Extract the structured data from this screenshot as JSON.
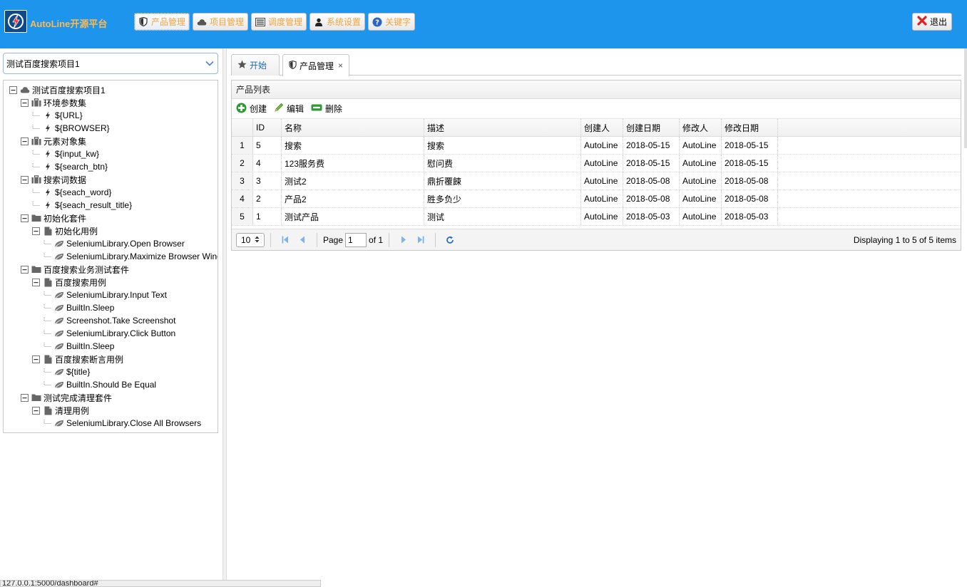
{
  "header": {
    "app_title": "AutoLine开源平台",
    "nav": [
      {
        "label": "产品管理",
        "icon": "shield-icon"
      },
      {
        "label": "项目管理",
        "icon": "cloud-icon"
      },
      {
        "label": "调度管理",
        "icon": "list-icon"
      },
      {
        "label": "系统设置",
        "icon": "user-icon"
      },
      {
        "label": "关键字",
        "icon": "help-icon"
      }
    ],
    "logout_label": "退出",
    "colors": {
      "bar": "#1e95ec",
      "nav_text": "#f2a33c"
    }
  },
  "sidebar": {
    "project_select": "测试百度搜索项目1",
    "tree": [
      {
        "label": "测试百度搜索项目1",
        "level": 0,
        "icon": "cloud-icon",
        "toggle": "minus"
      },
      {
        "label": "环境参数集",
        "level": 1,
        "icon": "suitcase-icon",
        "toggle": "minus"
      },
      {
        "label": "${URL}",
        "level": 2,
        "icon": "bolt-icon",
        "toggle": "none"
      },
      {
        "label": "${BROWSER}",
        "level": 2,
        "icon": "bolt-icon",
        "toggle": "none"
      },
      {
        "label": "元素对象集",
        "level": 1,
        "icon": "suitcase-icon",
        "toggle": "minus"
      },
      {
        "label": "${input_kw}",
        "level": 2,
        "icon": "bolt-icon",
        "toggle": "none"
      },
      {
        "label": "${search_btn}",
        "level": 2,
        "icon": "bolt-icon",
        "toggle": "none"
      },
      {
        "label": "搜索词数据",
        "level": 1,
        "icon": "suitcase-icon",
        "toggle": "minus"
      },
      {
        "label": "${seach_word}",
        "level": 2,
        "icon": "bolt-icon",
        "toggle": "none"
      },
      {
        "label": "${seach_result_title}",
        "level": 2,
        "icon": "bolt-icon",
        "toggle": "none"
      },
      {
        "label": "初始化套件",
        "level": 1,
        "icon": "folder-icon",
        "toggle": "minus"
      },
      {
        "label": "初始化用例",
        "level": 2,
        "icon": "file-icon",
        "toggle": "minus"
      },
      {
        "label": "SeleniumLibrary.Open Browser",
        "level": 3,
        "icon": "leaf-icon",
        "toggle": "none"
      },
      {
        "label": "SeleniumLibrary.Maximize Browser Window",
        "level": 3,
        "icon": "leaf-icon",
        "toggle": "none"
      },
      {
        "label": "百度搜索业务测试套件",
        "level": 1,
        "icon": "folder-icon",
        "toggle": "minus"
      },
      {
        "label": "百度搜索用例",
        "level": 2,
        "icon": "file-icon",
        "toggle": "minus"
      },
      {
        "label": "SeleniumLibrary.Input Text",
        "level": 3,
        "icon": "leaf-icon",
        "toggle": "none"
      },
      {
        "label": "BuiltIn.Sleep",
        "level": 3,
        "icon": "leaf-icon",
        "toggle": "none"
      },
      {
        "label": "Screenshot.Take Screenshot",
        "level": 3,
        "icon": "leaf-icon",
        "toggle": "none"
      },
      {
        "label": "SeleniumLibrary.Click Button",
        "level": 3,
        "icon": "leaf-icon",
        "toggle": "none"
      },
      {
        "label": "BuiltIn.Sleep",
        "level": 3,
        "icon": "leaf-icon",
        "toggle": "none"
      },
      {
        "label": "百度搜索断言用例",
        "level": 2,
        "icon": "file-icon",
        "toggle": "minus"
      },
      {
        "label": "${title}",
        "level": 3,
        "icon": "leaf-icon",
        "toggle": "none"
      },
      {
        "label": "BuiltIn.Should Be Equal",
        "level": 3,
        "icon": "leaf-icon",
        "toggle": "none"
      },
      {
        "label": "测试完成清理套件",
        "level": 1,
        "icon": "folder-icon",
        "toggle": "minus"
      },
      {
        "label": "清理用例",
        "level": 2,
        "icon": "file-icon",
        "toggle": "minus"
      },
      {
        "label": "SeleniumLibrary.Close All Browsers",
        "level": 3,
        "icon": "leaf-icon",
        "toggle": "none"
      }
    ]
  },
  "tabs": [
    {
      "label": "开始",
      "icon": "star-icon"
    },
    {
      "label": "产品管理",
      "icon": "shield-icon",
      "close": "×"
    }
  ],
  "panel": {
    "title": "产品列表",
    "toolbar": {
      "create": "创建",
      "edit": "编辑",
      "delete": "删除"
    },
    "columns": [
      "ID",
      "名称",
      "描述",
      "创建人",
      "创建日期",
      "修改人",
      "修改日期"
    ],
    "rows": [
      {
        "num": "1",
        "id": "5",
        "name": "搜索",
        "desc": "搜索",
        "creator": "AutoLine",
        "cdate": "2018-05-15",
        "modifier": "AutoLine",
        "mdate": "2018-05-15"
      },
      {
        "num": "2",
        "id": "4",
        "name": "123服务费",
        "desc": "慰问费",
        "creator": "AutoLine",
        "cdate": "2018-05-15",
        "modifier": "AutoLine",
        "mdate": "2018-05-15"
      },
      {
        "num": "3",
        "id": "3",
        "name": "测试2",
        "desc": "鼎折覆餗",
        "creator": "AutoLine",
        "cdate": "2018-05-08",
        "modifier": "AutoLine",
        "mdate": "2018-05-08"
      },
      {
        "num": "4",
        "id": "2",
        "name": "产品2",
        "desc": "胜多负少",
        "creator": "AutoLine",
        "cdate": "2018-05-08",
        "modifier": "AutoLine",
        "mdate": "2018-05-08"
      },
      {
        "num": "5",
        "id": "1",
        "name": "测试产品",
        "desc": "测试",
        "creator": "AutoLine",
        "cdate": "2018-05-03",
        "modifier": "AutoLine",
        "mdate": "2018-05-03"
      }
    ],
    "pager": {
      "page_size": "10",
      "page_label": "Page",
      "page_value": "1",
      "of_label": "of 1",
      "display": "Displaying 1 to 5 of 5 items"
    }
  },
  "status_url": "127.0.0.1:5000/dashboard#"
}
